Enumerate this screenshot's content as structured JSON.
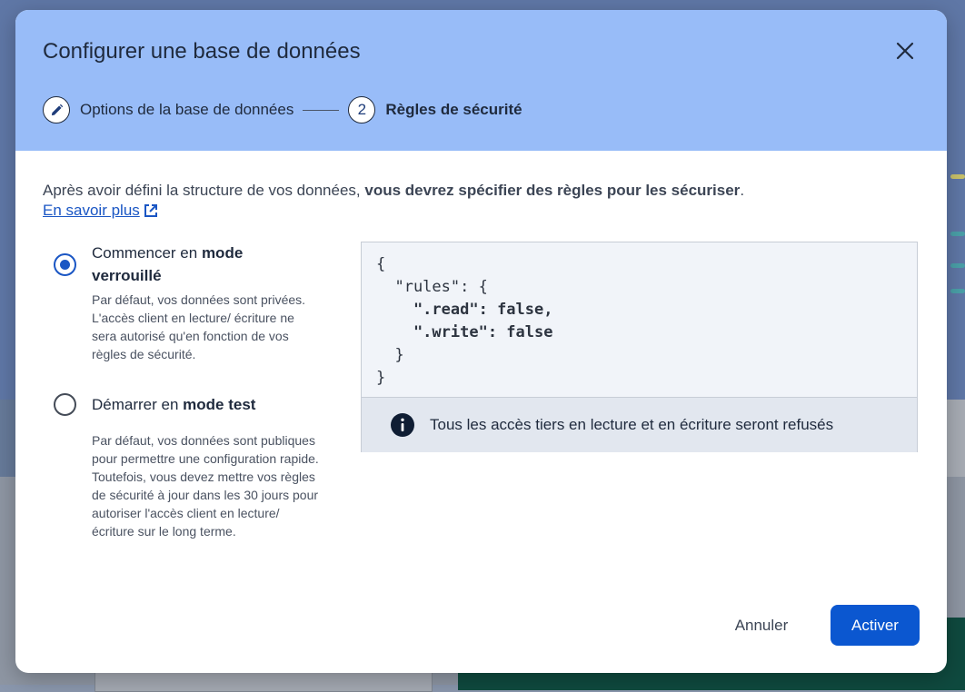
{
  "dialog": {
    "title": "Configurer une base de données",
    "close_icon": "close-icon"
  },
  "stepper": {
    "step1": {
      "label": "Options de la base de données",
      "icon": "edit-pencil-icon"
    },
    "step2": {
      "number": "2",
      "label": "Règles de sécurité"
    }
  },
  "intro": {
    "text_plain": "Après avoir défini la structure de vos données, ",
    "text_bold": "vous devrez spécifier des règles pour les sécuriser",
    "text_end": ".",
    "learn_more": "En savoir plus",
    "learn_more_icon": "external-link-icon"
  },
  "options": {
    "locked": {
      "title_plain": "Commencer en ",
      "title_bold": "mode verrouillé",
      "description": "Par défaut, vos données sont privées. L'accès client en lecture/ écriture ne sera autorisé qu'en fonction de vos règles de sécurité.",
      "selected": true
    },
    "test": {
      "title_plain": "Démarrer en ",
      "title_bold": "mode test",
      "description": "Par défaut, vos données sont publiques pour permettre une configuration rapide. Toutefois, vous devez mettre vos règles de sécurité à jour dans les 30 jours pour autoriser l'accès client en lecture/ écriture sur le long terme.",
      "selected": false
    }
  },
  "rules": {
    "line1": "{",
    "line2": "  \"rules\": {",
    "line3_key": "    \".read\"",
    "line3_val": ": false,",
    "line4_key": "    \".write\"",
    "line4_val": ": false",
    "line5": "  }",
    "line6": "}"
  },
  "notice": {
    "icon": "info-icon",
    "text": "Tous les accès tiers en lecture et en écriture seront refusés"
  },
  "actions": {
    "cancel": "Annuler",
    "enable": "Activer"
  },
  "colors": {
    "header_bg": "#98bcf8",
    "primary": "#0b57d0",
    "link": "#1a56c4"
  }
}
